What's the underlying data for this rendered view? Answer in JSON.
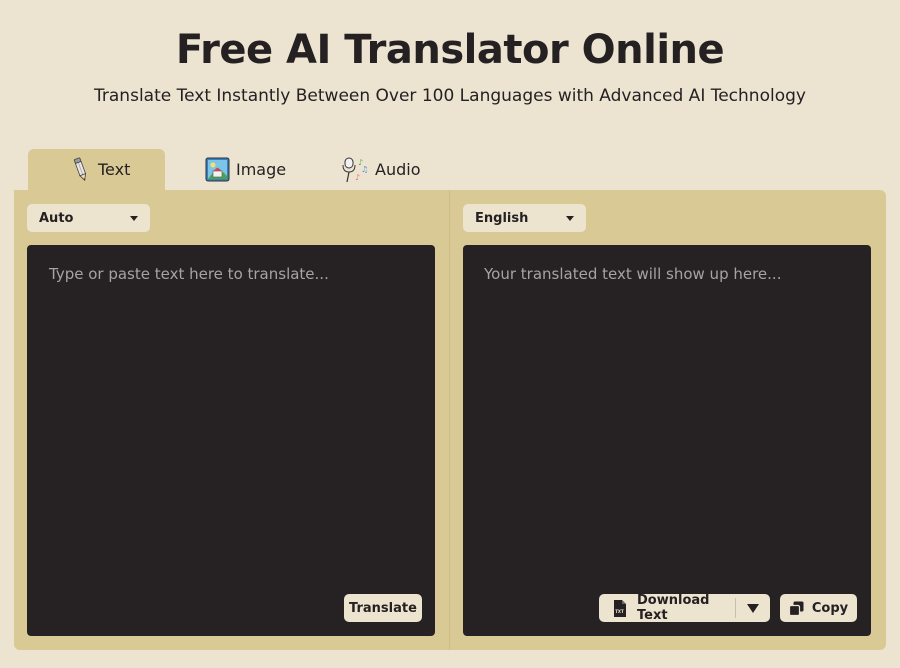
{
  "header": {
    "title": "Free AI Translator Online",
    "subtitle": "Translate Text Instantly Between Over 100 Languages with Advanced AI Technology"
  },
  "tabs": [
    {
      "label": "Text",
      "icon": "pencil-icon",
      "active": true
    },
    {
      "label": "Image",
      "icon": "image-icon",
      "active": false
    },
    {
      "label": "Audio",
      "icon": "audio-icon",
      "active": false
    }
  ],
  "source": {
    "language": "Auto",
    "placeholder": "Type or paste text here to translate...",
    "translate_label": "Translate"
  },
  "target": {
    "language": "English",
    "placeholder": "Your translated text will show up here...",
    "download_label": "Download Text",
    "copy_label": "Copy"
  },
  "colors": {
    "background": "#ece3d0",
    "panel": "#d9c995",
    "textbox": "#262224",
    "button": "#ede4d0",
    "text": "#252123"
  }
}
